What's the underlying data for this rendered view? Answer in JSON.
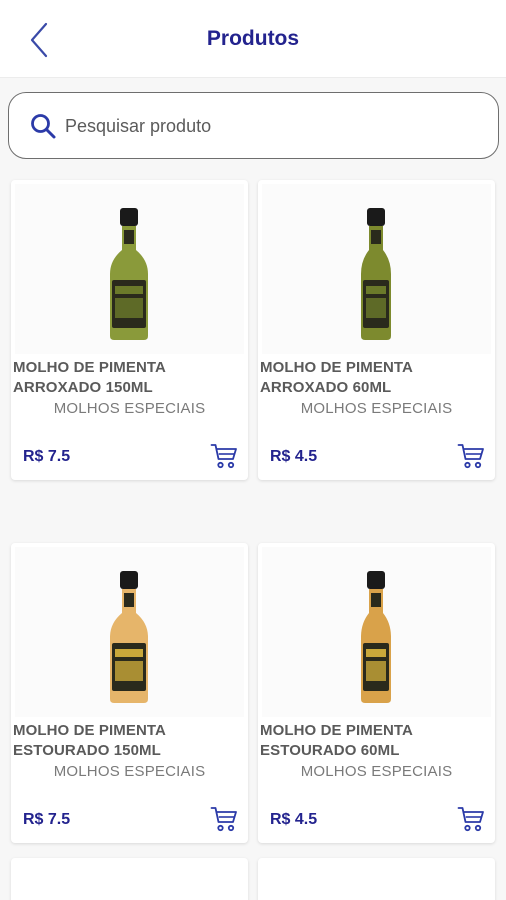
{
  "header": {
    "title": "Produtos"
  },
  "search": {
    "placeholder": "Pesquisar produto",
    "value": ""
  },
  "products": [
    {
      "name_line1": "MOLHO DE PIMENTA",
      "name_line2": "ARROXADO 150ML",
      "category": "MOLHOS ESPECIAIS",
      "price": "R$ 7.5",
      "label_color": "#6b7a2a",
      "liquid_color": "#8a9a3a"
    },
    {
      "name_line1": "MOLHO DE PIMENTA",
      "name_line2": "ARROXADO 60ML",
      "category": "MOLHOS ESPECIAIS",
      "price": "R$ 4.5",
      "label_color": "#6b7a2a",
      "liquid_color": "#7d8a2e"
    },
    {
      "name_line1": "MOLHO DE PIMENTA",
      "name_line2": "ESTOURADO 150ML",
      "category": "MOLHOS ESPECIAIS",
      "price": "R$ 7.5",
      "label_color": "#c9a83a",
      "liquid_color": "#e6b56a"
    },
    {
      "name_line1": "MOLHO DE PIMENTA",
      "name_line2": "ESTOURADO 60ML",
      "category": "MOLHOS ESPECIAIS",
      "price": "R$ 4.5",
      "label_color": "#c9a83a",
      "liquid_color": "#d9a24a"
    }
  ],
  "colors": {
    "accent": "#23238e",
    "text_gray": "#5a5a5a"
  },
  "icons": {
    "back": "chevron-left-icon",
    "search": "search-icon",
    "cart": "cart-icon"
  }
}
